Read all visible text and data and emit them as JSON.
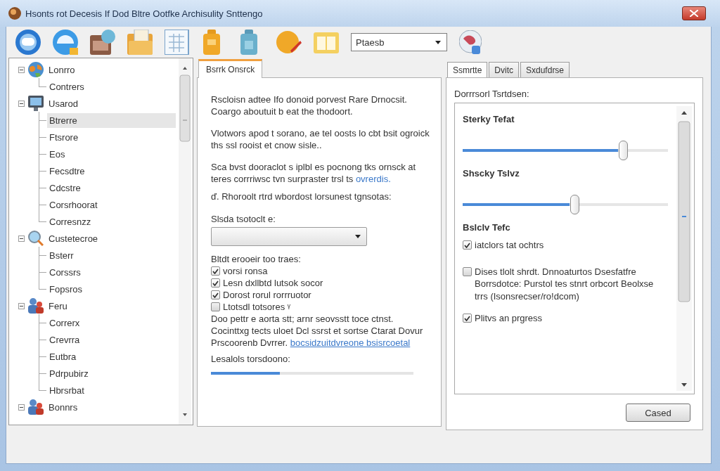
{
  "window": {
    "title": "Hsonts rot Decesis If Dod Bltre Ootfke Archisulity Snttengo"
  },
  "toolbar": {
    "dropdown": {
      "value": "Ptaesb"
    }
  },
  "tree": {
    "items": [
      {
        "label": "Lonrro",
        "expanded": true,
        "selected": false,
        "children": [
          {
            "label": "Contrers",
            "selected": false
          }
        ]
      },
      {
        "label": "Usarod",
        "expanded": true,
        "selected": false,
        "children": [
          {
            "label": "Btrerre",
            "selected": true
          },
          {
            "label": "Ftsrore",
            "selected": false
          },
          {
            "label": "Eos",
            "selected": false
          },
          {
            "label": "Fecsdtre",
            "selected": false
          },
          {
            "label": "Cdcstre",
            "selected": false
          },
          {
            "label": "Corsrhoorat",
            "selected": false
          },
          {
            "label": "Corresnzz",
            "selected": false
          }
        ]
      },
      {
        "label": "Custetecroe",
        "expanded": true,
        "selected": false,
        "children": [
          {
            "label": "Bsterr",
            "selected": false
          },
          {
            "label": "Corssrs",
            "selected": false
          },
          {
            "label": "Fopsros",
            "selected": false
          }
        ]
      },
      {
        "label": "Feru",
        "expanded": true,
        "selected": false,
        "children": [
          {
            "label": "Correrx",
            "selected": false
          },
          {
            "label": "Crevrra",
            "selected": false
          },
          {
            "label": "Eutbra",
            "selected": false
          },
          {
            "label": "Pdrpubirz",
            "selected": false
          },
          {
            "label": "Hbrsrbat",
            "selected": false
          }
        ]
      },
      {
        "label": "Bonnrs",
        "expanded": true,
        "selected": false
      }
    ]
  },
  "details_panel": {
    "tabs": [
      {
        "label": "Bsrrk Onsrck",
        "selected": true
      }
    ],
    "paragraphs": [
      {
        "text": "Rscloisn adtee Ifo donoid porvest Rare Drnocsit. Coargo aboutuit b eat the thodoort."
      },
      {
        "text": "Vlotwors apod t sorano, ae tel oosts lo cbt bsit ogroick ths ssl rooist et cnow sisle.."
      },
      {
        "text": "Sca bvst dooraclot s iplbl es pocnong tks ornsck at teres corrriwsc tvn surpraster trsl ts",
        "link": "ovrerdis."
      },
      {
        "text": "ď. Rhoroolt rtrd wbordost lorsunest tgnsotas:"
      }
    ],
    "select_label": "Slsda tsotoclt e:",
    "checklist_label": "Bltdt erooeir too traes:",
    "checkboxes": [
      {
        "label": "vorsi ronsa",
        "checked": true
      },
      {
        "label": "Lesn dxllbtd lutsok socor",
        "checked": true
      },
      {
        "label": "Dorost rorul rorrruotor",
        "checked": true
      },
      {
        "label": "Ltotsdl totsores ᵞ",
        "checked": false
      }
    ],
    "note": {
      "text": "Doo pettr e aorta stt; arnr seovsstt toce ctnst. Cocinttxg tects uloet Dcl ssrst et sortse Ctarat Dovur Prscoorenb Dvrrer.",
      "link": "bocsidzuitdvreone bsisrcoetal"
    },
    "progress": {
      "label": "Lesalols torsdoono:",
      "level": 0.34
    }
  },
  "settings_panel": {
    "tabs": [
      {
        "label": "Ssmrtte",
        "selected": true
      },
      {
        "label": "Dvitc",
        "selected": false
      },
      {
        "label": "Sxdufdrse",
        "selected": false
      }
    ],
    "group_label": "Dorrrsorl Tsrtdsen:",
    "sliders": [
      {
        "label": "Sterky Tefat",
        "level": 0.78
      },
      {
        "label": "Shscky Tslvz",
        "level": 0.545
      }
    ],
    "section_title": "Bslclv Tefc",
    "options": [
      {
        "label": "iatclors tat ochtrs",
        "checked": true
      },
      {
        "label": "Dises tlolt shrdt. Dnnoaturtos Dsesfatfre Borrsdotce: Purstol tes stnrt orbcort Beolxse trrs (Isonsrecser/ro!dcom)",
        "checked": false
      },
      {
        "label": "Plitvs an prgress",
        "checked": true
      }
    ]
  },
  "buttons": [
    {
      "label": "Cased"
    }
  ]
}
